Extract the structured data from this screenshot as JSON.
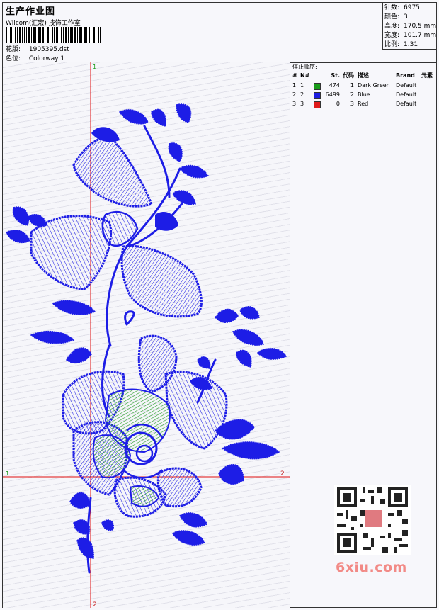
{
  "header": {
    "title": "生产作业图",
    "company": "Wilcom(汇宏) 技饰工作室",
    "pattern_label": "花版:",
    "pattern_value": "1905395.dst",
    "colorway_label": "色位:",
    "colorway_value": "Colorway 1"
  },
  "stats": [
    {
      "label": "针数:",
      "value": "6975"
    },
    {
      "label": "颜色:",
      "value": "3"
    },
    {
      "label": "高度:",
      "value": "170.5 mm"
    },
    {
      "label": "宽度:",
      "value": "101.7 mm"
    },
    {
      "label": "比例:",
      "value": "1.31"
    }
  ],
  "color_table": {
    "title": "停止顺序:",
    "headers": {
      "hash": "#",
      "no": "N#",
      "st": "St.",
      "code": "代码",
      "desc": "描述",
      "brand": "Brand",
      "element": "元素"
    },
    "rows": [
      {
        "idx": "1.",
        "no": "1",
        "swatch": "#1a9c1a",
        "stitches": "474",
        "code": "1",
        "desc": "Dark Green",
        "brand": "Default"
      },
      {
        "idx": "2.",
        "no": "2",
        "swatch": "#1d1de0",
        "stitches": "6499",
        "code": "2",
        "desc": "Blue",
        "brand": "Default"
      },
      {
        "idx": "3.",
        "no": "3",
        "swatch": "#e01a1a",
        "stitches": "0",
        "code": "3",
        "desc": "Red",
        "brand": "Default"
      }
    ]
  },
  "axes": {
    "top": "1",
    "left": "1",
    "right": "2",
    "bottom": "2"
  },
  "colors": {
    "thread_blue": "#1d1de6",
    "thread_green": "#1f9c1f",
    "axis_red": "#e01010"
  },
  "watermark": "6xiu.com"
}
